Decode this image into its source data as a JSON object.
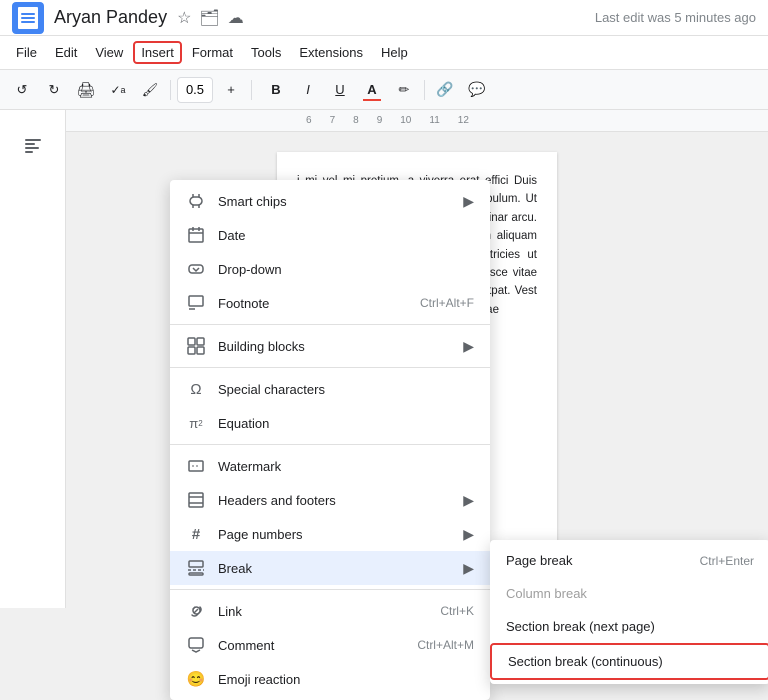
{
  "titleBar": {
    "docTitle": "Aryan Pandey",
    "lastEdit": "Last edit was 5 minutes ago",
    "icons": [
      "star",
      "folder",
      "cloud"
    ]
  },
  "menuBar": {
    "items": [
      "File",
      "Edit",
      "View",
      "Insert",
      "Format",
      "Tools",
      "Extensions",
      "Help"
    ]
  },
  "toolbar": {
    "undo": "↺",
    "redo": "↻",
    "print": "🖨",
    "spellcheck": "✓",
    "paintFormat": "🎨",
    "fontSize": "0.5",
    "plus": "+",
    "bold": "B",
    "italic": "I",
    "underline": "U",
    "textColor": "A",
    "highlight": "✏",
    "link": "🔗",
    "comment": "💬"
  },
  "rulerNumbers": [
    "6",
    "7",
    "8",
    "9",
    "10",
    "11",
    "12"
  ],
  "docContent": "i mi vel mi pretium, a viverra erat effici Duis pretium neque ligula, et pulvinar m bulum. Ut id neque eget tortor mattis tri nia pulvinar arcu. Pellentesque sceleris eros sed enim aliquam lobortis. Sed lob uis mattis vel, ultricies ut purus. Ut facilis icitudin euismod. Fusce vitae vestibul commodo. Aliquam erat volutpat. Vest fringilla venenatis. Etiam id mauris vitae",
  "insertMenu": {
    "items": [
      {
        "id": "smart-chips",
        "icon": "chip",
        "label": "Smart chips",
        "hasArrow": true,
        "shortcut": ""
      },
      {
        "id": "date",
        "icon": "date",
        "label": "Date",
        "hasArrow": false,
        "shortcut": ""
      },
      {
        "id": "dropdown",
        "icon": "dropdown",
        "label": "Drop-down",
        "hasArrow": false,
        "shortcut": ""
      },
      {
        "id": "footnote",
        "icon": "footnote",
        "label": "Footnote",
        "hasArrow": false,
        "shortcut": "Ctrl+Alt+F"
      },
      {
        "id": "sep1",
        "type": "separator"
      },
      {
        "id": "building-blocks",
        "icon": "blocks",
        "label": "Building blocks",
        "hasArrow": true,
        "shortcut": ""
      },
      {
        "id": "sep2",
        "type": "separator"
      },
      {
        "id": "special-characters",
        "icon": "omega",
        "label": "Special characters",
        "hasArrow": false,
        "shortcut": ""
      },
      {
        "id": "equation",
        "icon": "pi",
        "label": "Equation",
        "hasArrow": false,
        "shortcut": ""
      },
      {
        "id": "sep3",
        "type": "separator"
      },
      {
        "id": "watermark",
        "icon": "watermark",
        "label": "Watermark",
        "hasArrow": false,
        "shortcut": ""
      },
      {
        "id": "headers-footers",
        "icon": "header",
        "label": "Headers and footers",
        "hasArrow": true,
        "shortcut": ""
      },
      {
        "id": "page-numbers",
        "icon": "hash",
        "label": "Page numbers",
        "hasArrow": true,
        "shortcut": ""
      },
      {
        "id": "break",
        "icon": "break",
        "label": "Break",
        "hasArrow": true,
        "shortcut": "",
        "highlighted": true
      },
      {
        "id": "sep4",
        "type": "separator"
      },
      {
        "id": "link",
        "icon": "link",
        "label": "Link",
        "hasArrow": false,
        "shortcut": "Ctrl+K"
      },
      {
        "id": "comment",
        "icon": "comment",
        "label": "Comment",
        "hasArrow": false,
        "shortcut": "Ctrl+Alt+M"
      },
      {
        "id": "emoji",
        "icon": "emoji",
        "label": "Emoji reaction",
        "hasArrow": false,
        "shortcut": ""
      }
    ]
  },
  "breakSubmenu": {
    "items": [
      {
        "id": "page-break",
        "label": "Page break",
        "shortcut": "Ctrl+Enter",
        "grayed": false,
        "outlined": false
      },
      {
        "id": "column-break",
        "label": "Column break",
        "shortcut": "",
        "grayed": true,
        "outlined": false
      },
      {
        "id": "section-break-next",
        "label": "Section break (next page)",
        "shortcut": "",
        "grayed": false,
        "outlined": false
      },
      {
        "id": "section-break-continuous",
        "label": "Section break (continuous)",
        "shortcut": "",
        "grayed": false,
        "outlined": true
      }
    ]
  }
}
